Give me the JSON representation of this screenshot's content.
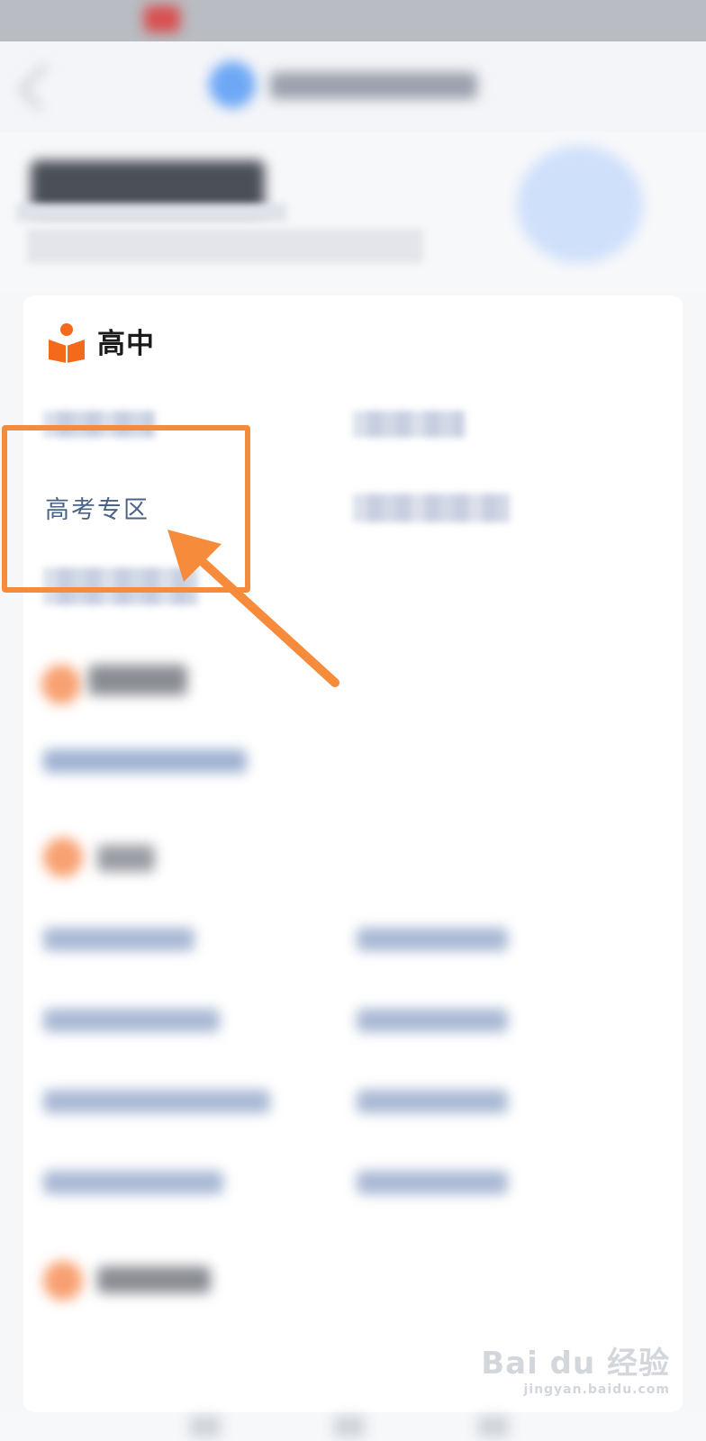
{
  "section": {
    "title": "高中",
    "icon": "book-reader-icon",
    "accent_color": "#f56a1a"
  },
  "links": {
    "gaokao_zone": "高考专区"
  },
  "annotation": {
    "color": "#f68b3c"
  },
  "watermark": {
    "brand": "Bai du 经验",
    "url": "jingyan.baidu.com"
  }
}
